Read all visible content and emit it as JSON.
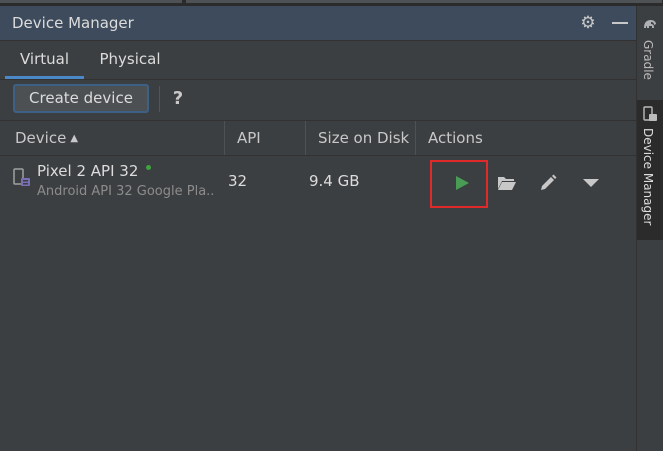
{
  "window": {
    "title": "Device Manager"
  },
  "tabs": [
    {
      "label": "Virtual",
      "active": true
    },
    {
      "label": "Physical",
      "active": false
    }
  ],
  "toolbar": {
    "create_label": "Create device",
    "help_label": "?"
  },
  "table": {
    "columns": [
      "Device",
      "API",
      "Size on Disk",
      "Actions"
    ],
    "sort_column": "Device",
    "sort_direction": "ascending",
    "rows": [
      {
        "name": "Pixel 2 API 32",
        "subtitle": "Android API 32 Google Pla...",
        "api": "32",
        "size": "9.4 GB",
        "status_color": "#3fa33f",
        "actions": [
          "run-icon",
          "folder-icon",
          "edit-icon",
          "more-dropdown-icon"
        ]
      }
    ]
  },
  "sidebar": {
    "items": [
      {
        "label": "Gradle",
        "active": false
      },
      {
        "label": "Device Manager",
        "active": true
      }
    ]
  },
  "colors": {
    "accent": "#4a88c7",
    "run_green": "#499c54",
    "highlight_box": "#e02a2a"
  }
}
